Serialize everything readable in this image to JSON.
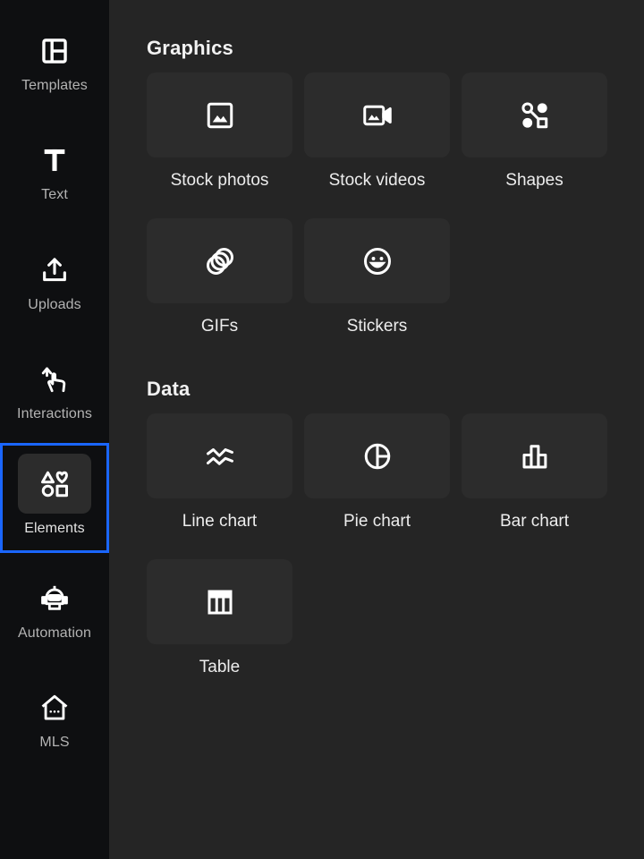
{
  "sidebar": {
    "items": [
      {
        "label": "Templates",
        "icon": "templates-icon"
      },
      {
        "label": "Text",
        "icon": "text-icon"
      },
      {
        "label": "Uploads",
        "icon": "upload-icon"
      },
      {
        "label": "Interactions",
        "icon": "interaction-hand-icon"
      },
      {
        "label": "Elements",
        "icon": "elements-icon",
        "selected": true
      },
      {
        "label": "Automation",
        "icon": "robot-icon"
      },
      {
        "label": "MLS",
        "icon": "house-icon"
      }
    ],
    "selected_border_color": "#1a66ff"
  },
  "graphics": {
    "title": "Graphics",
    "items": [
      {
        "label": "Stock photos",
        "icon": "image-icon"
      },
      {
        "label": "Stock videos",
        "icon": "video-camera-icon"
      },
      {
        "label": "Shapes",
        "icon": "shapes-icon"
      },
      {
        "label": "GIFs",
        "icon": "gif-rings-icon"
      },
      {
        "label": "Stickers",
        "icon": "smiley-icon"
      }
    ]
  },
  "data_section": {
    "title": "Data",
    "items": [
      {
        "label": "Line chart",
        "icon": "line-chart-icon"
      },
      {
        "label": "Pie chart",
        "icon": "pie-chart-icon"
      },
      {
        "label": "Bar chart",
        "icon": "bar-chart-icon"
      },
      {
        "label": "Table",
        "icon": "table-icon"
      }
    ]
  }
}
